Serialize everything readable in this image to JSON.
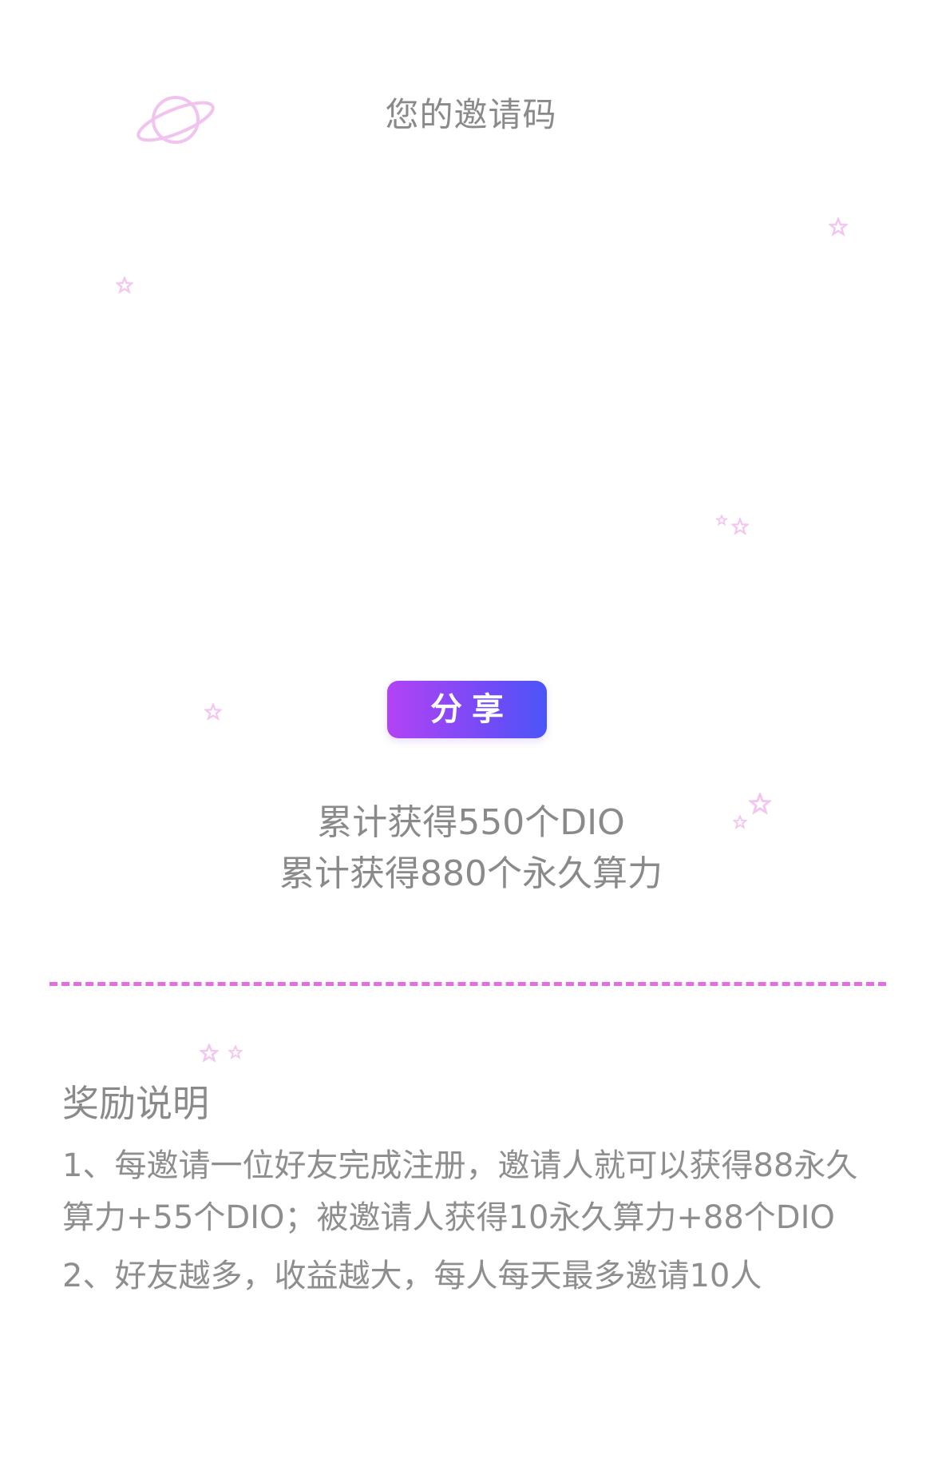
{
  "invite": {
    "title": "您的邀请码"
  },
  "share_button": {
    "label": "分享"
  },
  "stats": {
    "dio_total": "累计获得550个DIO",
    "power_total": "累计获得880个永久算力"
  },
  "reward": {
    "title": "奖励说明",
    "rules": [
      "1、每邀请一位好友完成注册，邀请人就可以获得88永久算力+55个DIO；被邀请人获得10永久算力+88个DIO",
      "2、好友越多，收益越大，每人每天最多邀请10人"
    ]
  },
  "colors": {
    "accent_start": "#b243f5",
    "accent_end": "#4b56f8",
    "divider": "#e36ee0",
    "decor": "#f3c6ef"
  }
}
